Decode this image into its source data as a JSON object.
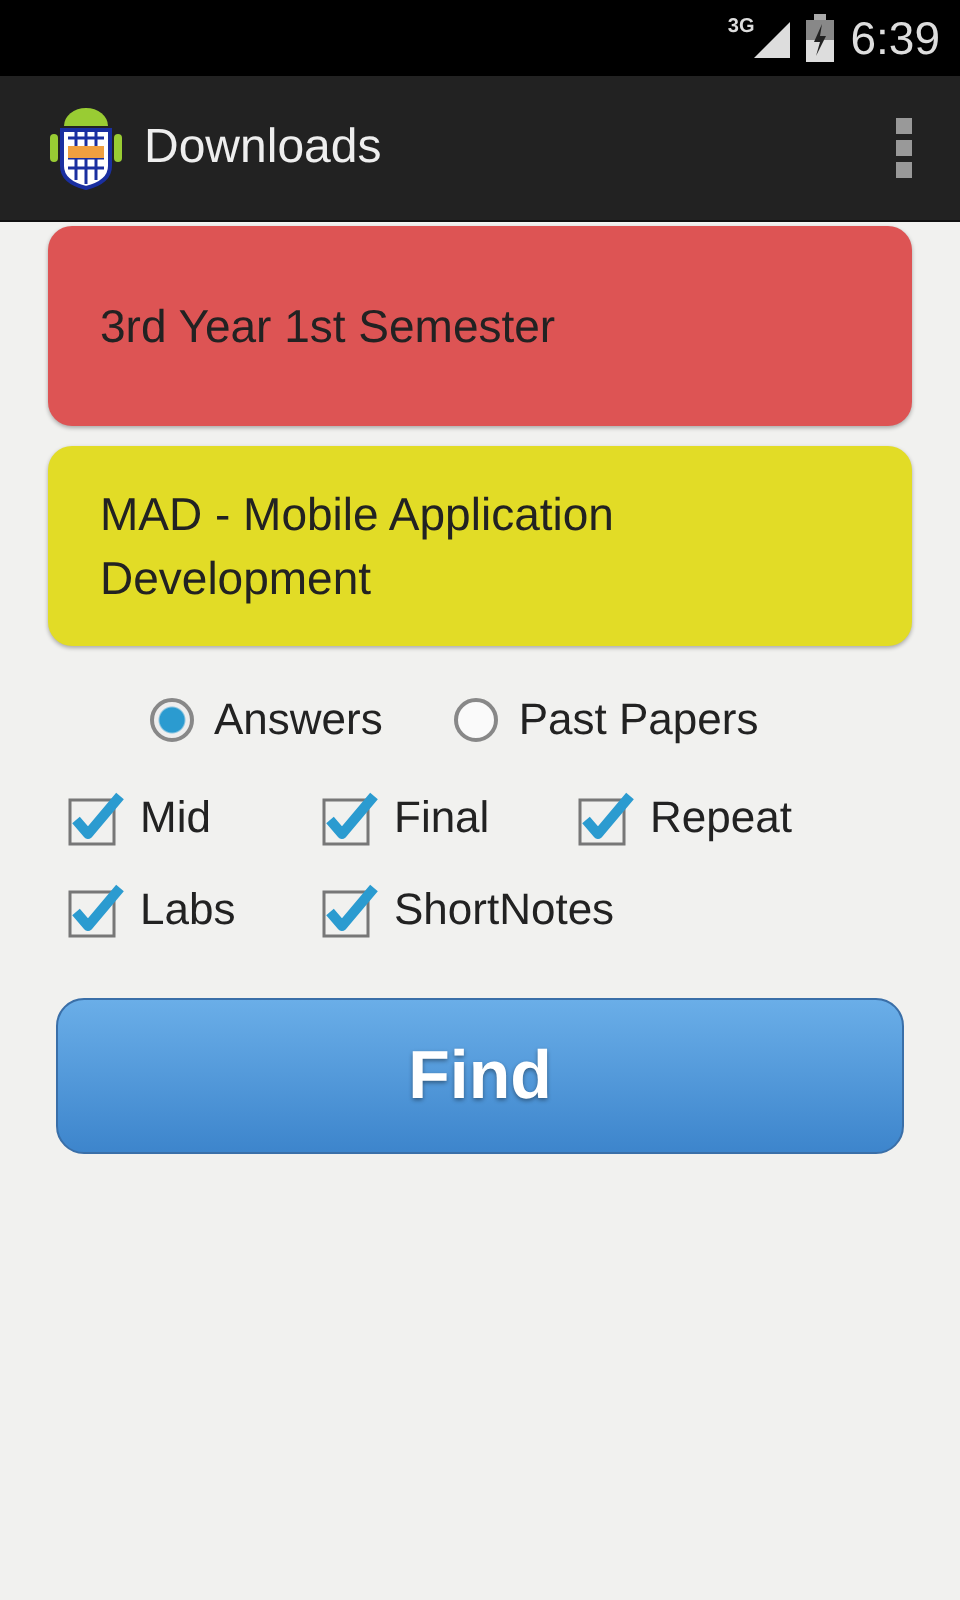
{
  "status_bar": {
    "network": "3G",
    "time": "6:39"
  },
  "action_bar": {
    "title": "Downloads"
  },
  "cards": [
    {
      "text": "3rd Year 1st Semester",
      "color": "#dd5454"
    },
    {
      "text": "MAD - Mobile Application Development",
      "color": "#e2dc26"
    }
  ],
  "radios": [
    {
      "label": "Answers",
      "selected": true
    },
    {
      "label": "Past Papers",
      "selected": false
    }
  ],
  "checkboxes": [
    {
      "label": "Mid",
      "checked": true
    },
    {
      "label": "Final",
      "checked": true
    },
    {
      "label": "Repeat",
      "checked": true
    },
    {
      "label": "Labs",
      "checked": true
    },
    {
      "label": "ShortNotes",
      "checked": true
    }
  ],
  "button": {
    "label": "Find"
  }
}
